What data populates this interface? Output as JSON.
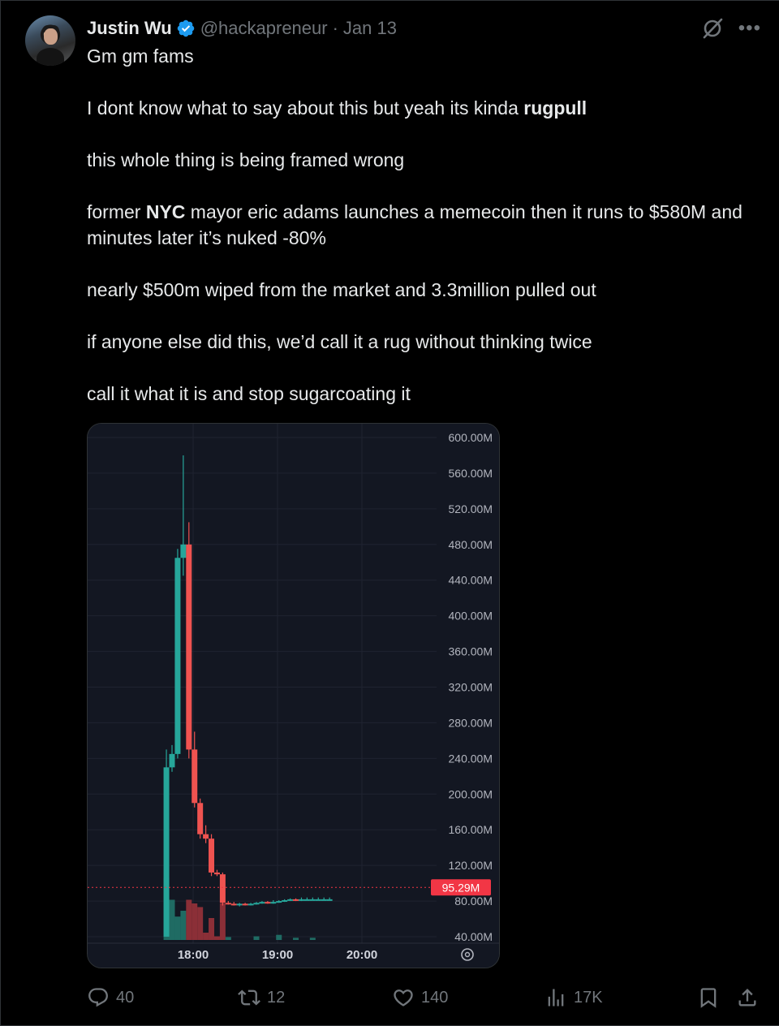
{
  "author": {
    "name": "Justin Wu",
    "handle": "@hackapreneur",
    "separator": "·",
    "date": "Jan 13",
    "verified": true
  },
  "tweet": {
    "greeting": "Gm gm fams",
    "p1_before": "I dont know what to say about this but yeah its kinda ",
    "p1_bold": "rugpull",
    "p2": "this whole thing is being framed wrong",
    "p3_before": "former ",
    "p3_bold": "NYC",
    "p3_after": " mayor eric adams launches a memecoin then it runs to $580M and minutes later it’s nuked -80%",
    "p4": "nearly $500m wiped from the market and 3.3million pulled out",
    "p5": "if anyone else did this, we’d call it a rug without thinking twice",
    "p6": "call it what it is and stop sugarcoating it"
  },
  "actions": {
    "replies": "40",
    "reposts": "12",
    "likes": "140",
    "views": "17K"
  },
  "icons": [
    "verified-badge-icon",
    "grok-icon",
    "more-icon",
    "reply-icon",
    "repost-icon",
    "like-icon",
    "views-icon",
    "bookmark-icon",
    "share-icon",
    "chart-settings-icon"
  ],
  "colors": {
    "up": "#26a69a",
    "down": "#ef5350",
    "price_tag": "#f23645",
    "verified": "#1d9bf0"
  },
  "chart_data": {
    "type": "candlestick",
    "y_ticks": [
      "600.00M",
      "560.00M",
      "520.00M",
      "480.00M",
      "440.00M",
      "400.00M",
      "360.00M",
      "320.00M",
      "280.00M",
      "240.00M",
      "200.00M",
      "160.00M",
      "120.00M",
      "80.00M",
      "40.00M"
    ],
    "x_ticks": [
      "18:00",
      "19:00",
      "20:00"
    ],
    "current_price_label": "95.29M",
    "current_price": 95.29,
    "ylim": [
      30,
      615
    ],
    "x_time_range": [
      "17:20",
      "20:40"
    ],
    "candles": [
      {
        "t": "17:41",
        "o": 40,
        "h": 250,
        "l": 40,
        "c": 230
      },
      {
        "t": "17:45",
        "o": 230,
        "h": 255,
        "l": 225,
        "c": 245
      },
      {
        "t": "17:49",
        "o": 245,
        "h": 475,
        "l": 240,
        "c": 465
      },
      {
        "t": "17:53",
        "o": 465,
        "h": 580,
        "l": 445,
        "c": 480
      },
      {
        "t": "17:57",
        "o": 480,
        "h": 505,
        "l": 240,
        "c": 250
      },
      {
        "t": "18:01",
        "o": 250,
        "h": 270,
        "l": 185,
        "c": 190
      },
      {
        "t": "18:05",
        "o": 190,
        "h": 195,
        "l": 150,
        "c": 155
      },
      {
        "t": "18:09",
        "o": 155,
        "h": 165,
        "l": 145,
        "c": 150
      },
      {
        "t": "18:13",
        "o": 150,
        "h": 155,
        "l": 108,
        "c": 112
      },
      {
        "t": "18:17",
        "o": 112,
        "h": 115,
        "l": 108,
        "c": 110
      },
      {
        "t": "18:21",
        "o": 110,
        "h": 112,
        "l": 75,
        "c": 78
      },
      {
        "t": "18:25",
        "o": 78,
        "h": 80,
        "l": 76,
        "c": 77
      },
      {
        "t": "18:29",
        "o": 77,
        "h": 79,
        "l": 75,
        "c": 76
      },
      {
        "t": "18:33",
        "o": 76,
        "h": 78,
        "l": 74,
        "c": 77
      },
      {
        "t": "18:37",
        "o": 77,
        "h": 78,
        "l": 75,
        "c": 76
      },
      {
        "t": "18:41",
        "o": 76,
        "h": 78,
        "l": 75,
        "c": 77
      },
      {
        "t": "18:45",
        "o": 77,
        "h": 79,
        "l": 76,
        "c": 78
      },
      {
        "t": "18:49",
        "o": 78,
        "h": 80,
        "l": 77,
        "c": 79
      },
      {
        "t": "18:53",
        "o": 79,
        "h": 80,
        "l": 77,
        "c": 78
      },
      {
        "t": "18:57",
        "o": 78,
        "h": 81,
        "l": 77,
        "c": 79
      },
      {
        "t": "19:01",
        "o": 79,
        "h": 81,
        "l": 78,
        "c": 80
      },
      {
        "t": "19:05",
        "o": 80,
        "h": 82,
        "l": 79,
        "c": 81
      },
      {
        "t": "19:09",
        "o": 81,
        "h": 83,
        "l": 80,
        "c": 82
      },
      {
        "t": "19:13",
        "o": 82,
        "h": 83,
        "l": 80,
        "c": 81
      },
      {
        "t": "19:17",
        "o": 81,
        "h": 84,
        "l": 80,
        "c": 82
      },
      {
        "t": "19:21",
        "o": 82,
        "h": 84,
        "l": 81,
        "c": 82
      },
      {
        "t": "19:25",
        "o": 82,
        "h": 84,
        "l": 81,
        "c": 82
      },
      {
        "t": "19:29",
        "o": 82,
        "h": 84,
        "l": 81,
        "c": 82
      },
      {
        "t": "19:33",
        "o": 82,
        "h": 84,
        "l": 81,
        "c": 82
      },
      {
        "t": "19:37",
        "o": 82,
        "h": 84,
        "l": 81,
        "c": 82
      }
    ],
    "volume": [
      {
        "t": "17:41",
        "v": 0.85,
        "dir": "up"
      },
      {
        "t": "17:45",
        "v": 0.55,
        "dir": "up"
      },
      {
        "t": "17:49",
        "v": 0.32,
        "dir": "up"
      },
      {
        "t": "17:53",
        "v": 0.4,
        "dir": "up"
      },
      {
        "t": "17:57",
        "v": 0.55,
        "dir": "down"
      },
      {
        "t": "18:01",
        "v": 0.5,
        "dir": "down"
      },
      {
        "t": "18:05",
        "v": 0.45,
        "dir": "down"
      },
      {
        "t": "18:09",
        "v": 0.1,
        "dir": "down"
      },
      {
        "t": "18:13",
        "v": 0.3,
        "dir": "down"
      },
      {
        "t": "18:17",
        "v": 0.05,
        "dir": "down"
      },
      {
        "t": "18:21",
        "v": 0.5,
        "dir": "down"
      },
      {
        "t": "18:25",
        "v": 0.04,
        "dir": "up"
      },
      {
        "t": "18:45",
        "v": 0.05,
        "dir": "up"
      },
      {
        "t": "19:01",
        "v": 0.07,
        "dir": "up"
      },
      {
        "t": "19:13",
        "v": 0.03,
        "dir": "up"
      },
      {
        "t": "19:25",
        "v": 0.03,
        "dir": "up"
      }
    ]
  }
}
